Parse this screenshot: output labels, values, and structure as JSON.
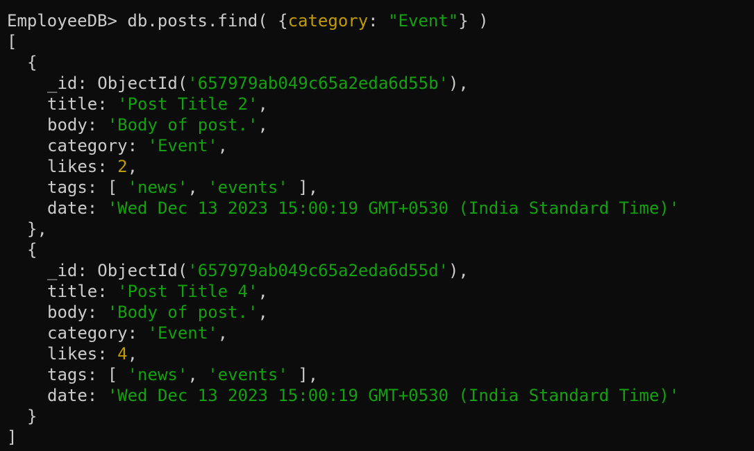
{
  "prompt": "EmployeeDB> ",
  "command": {
    "pre": "db.posts.find( {",
    "key": "category",
    "colon": ": ",
    "value": "\"Event\"",
    "post": "} )"
  },
  "open_array": "[",
  "close_array": "]",
  "open_obj": "{",
  "close_obj_comma": "},",
  "close_obj": "}",
  "comma": ",",
  "labels": {
    "id": "_id: ",
    "title": "title: ",
    "body": "body: ",
    "category": "category: ",
    "likes": "likes: ",
    "tags": "tags: ",
    "date": "date: ",
    "objectid_open": "ObjectId(",
    "objectid_close": "),",
    "tags_open": "[ ",
    "tags_sep": ", ",
    "tags_close": " ],"
  },
  "documents": [
    {
      "id": "'657979ab049c65a2eda6d55b'",
      "title": "'Post Title 2'",
      "body": "'Body of post.'",
      "category": "'Event'",
      "likes": "2",
      "tags": [
        "'news'",
        "'events'"
      ],
      "date": "'Wed Dec 13 2023 15:00:19 GMT+0530 (India Standard Time)'"
    },
    {
      "id": "'657979ab049c65a2eda6d55d'",
      "title": "'Post Title 4'",
      "body": "'Body of post.'",
      "category": "'Event'",
      "likes": "4",
      "tags": [
        "'news'",
        "'events'"
      ],
      "date": "'Wed Dec 13 2023 15:00:19 GMT+0530 (India Standard Time)'"
    }
  ],
  "colors": {
    "background": "#0c0c0c",
    "text": "#cccccc",
    "string": "#13a10e",
    "number": "#c19c00"
  }
}
